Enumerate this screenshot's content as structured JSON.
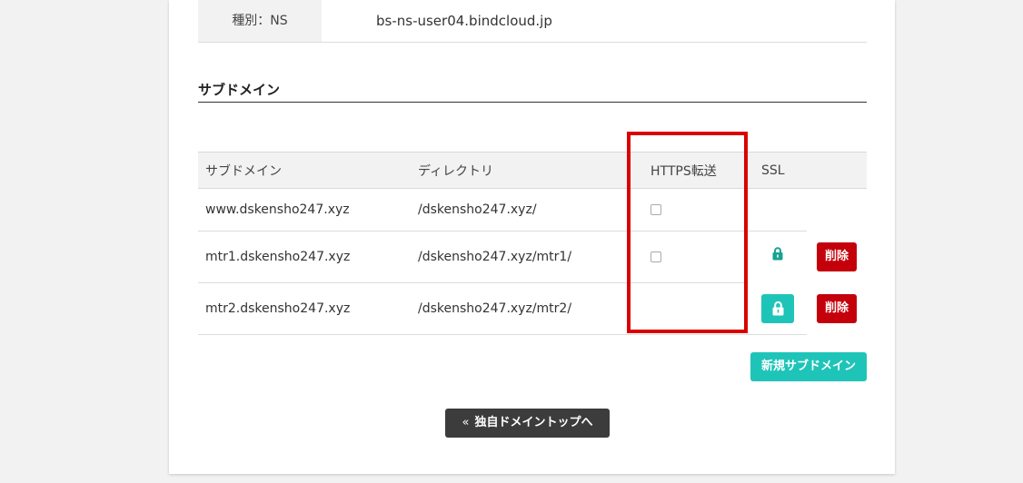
{
  "ns_record": {
    "key": "種別：NS",
    "value": "bs-ns-user04.bindcloud.jp"
  },
  "section": {
    "title": "サブドメイン"
  },
  "table": {
    "headers": {
      "subdomain": "サブドメイン",
      "directory": "ディレクトリ",
      "https": "HTTPS転送",
      "ssl": "SSL"
    },
    "rows": [
      {
        "subdomain": "www.dskensho247.xyz",
        "directory": "/dskensho247.xyz/",
        "https_checkbox": true,
        "ssl": "none",
        "delete": false
      },
      {
        "subdomain": "mtr1.dskensho247.xyz",
        "directory": "/dskensho247.xyz/mtr1/",
        "https_checkbox": true,
        "ssl": "lock-icon",
        "delete": true
      },
      {
        "subdomain": "mtr2.dskensho247.xyz",
        "directory": "/dskensho247.xyz/mtr2/",
        "https_checkbox": false,
        "ssl": "lock-button",
        "delete": true
      }
    ],
    "delete_label": "削除"
  },
  "buttons": {
    "new_subdomain": "新規サブドメイン",
    "back_chevron": "«",
    "back_to_top": "独自ドメイントップへ"
  },
  "colors": {
    "accent_teal": "#1fc4b8",
    "delete_red": "#c4000a",
    "highlight_red": "#d90000",
    "dark_button": "#3c3c3c"
  }
}
